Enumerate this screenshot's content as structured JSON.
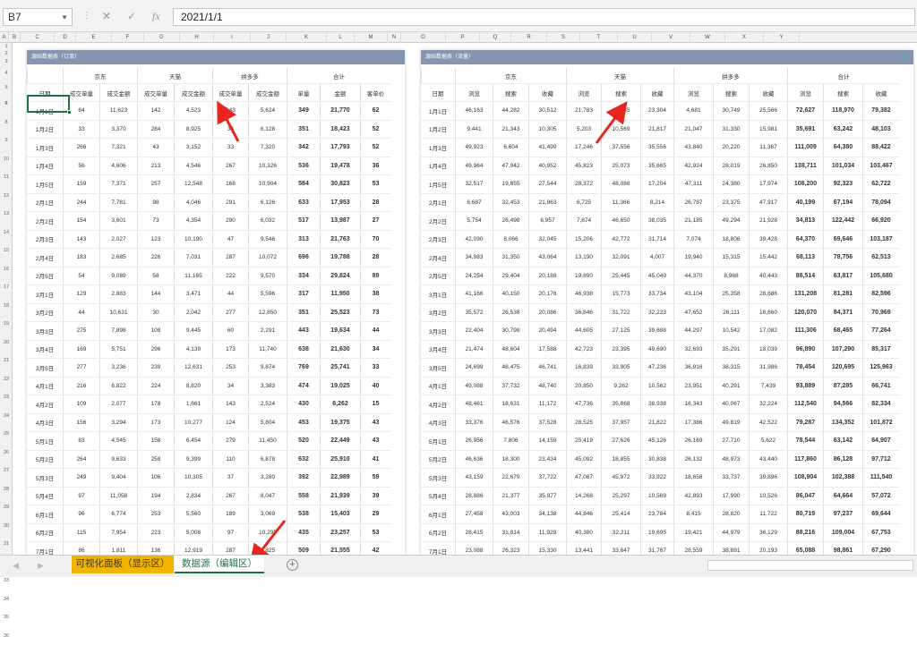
{
  "formula_bar": {
    "cell_ref": "B7",
    "formula": "2021/1/1",
    "cancel_icon": "✕",
    "confirm_icon": "✓",
    "fx_label": "fx"
  },
  "columns": [
    "A",
    "B",
    "C",
    "D",
    "E",
    "F",
    "G",
    "H",
    "I",
    "J",
    "K",
    "L",
    "M",
    "N",
    "O",
    "P",
    "Q",
    "R",
    "S",
    "T",
    "U",
    "V",
    "W",
    "X",
    "Y"
  ],
  "rows": [
    "1",
    "2",
    "3",
    "4",
    "5",
    "6",
    "7",
    "8",
    "9",
    "10",
    "11",
    "12",
    "13",
    "14",
    "15",
    "16",
    "17",
    "18",
    "19",
    "20",
    "21",
    "22",
    "23",
    "24",
    "25",
    "26",
    "27",
    "28",
    "29",
    "30",
    "31",
    "32",
    "33",
    "34",
    "35",
    "36"
  ],
  "left_table": {
    "title": "源始数据表（订单）",
    "group_headers": {
      "jd": "京东",
      "tmall": "天猫",
      "pdd": "拼多多",
      "total": "合计"
    },
    "headers": [
      "日期",
      "成交单量",
      "成交金额",
      "成交单量",
      "成交金额",
      "成交单量",
      "成交金额",
      "单量",
      "金额",
      "客单价"
    ],
    "rows": [
      [
        "1月1日",
        "64",
        "11,623",
        "142",
        "4,523",
        "143",
        "5,624",
        "349",
        "21,770",
        "62"
      ],
      [
        "1月2日",
        "33",
        "3,370",
        "284",
        "8,925",
        "34",
        "6,128",
        "351",
        "18,423",
        "52"
      ],
      [
        "1月3日",
        "266",
        "7,321",
        "43",
        "3,152",
        "33",
        "7,320",
        "342",
        "17,793",
        "52"
      ],
      [
        "1月4日",
        "56",
        "4,606",
        "213",
        "4,546",
        "267",
        "10,326",
        "536",
        "19,478",
        "36"
      ],
      [
        "1月5日",
        "159",
        "7,371",
        "257",
        "12,548",
        "168",
        "10,904",
        "584",
        "30,823",
        "53"
      ],
      [
        "2月1日",
        "244",
        "7,781",
        "98",
        "4,046",
        "291",
        "6,126",
        "633",
        "17,953",
        "28"
      ],
      [
        "2月2日",
        "154",
        "3,601",
        "73",
        "4,354",
        "290",
        "6,032",
        "517",
        "13,987",
        "27"
      ],
      [
        "2月3日",
        "143",
        "2,027",
        "123",
        "10,190",
        "47",
        "9,546",
        "313",
        "21,763",
        "70"
      ],
      [
        "2月4日",
        "183",
        "2,685",
        "226",
        "7,031",
        "287",
        "10,072",
        "696",
        "19,788",
        "28"
      ],
      [
        "2月5日",
        "54",
        "9,089",
        "58",
        "11,165",
        "222",
        "9,570",
        "334",
        "29,824",
        "89"
      ],
      [
        "3月1日",
        "129",
        "2,883",
        "144",
        "3,471",
        "44",
        "5,596",
        "317",
        "11,950",
        "38"
      ],
      [
        "3月2日",
        "44",
        "10,631",
        "30",
        "2,042",
        "277",
        "12,850",
        "351",
        "25,523",
        "73"
      ],
      [
        "3月3日",
        "275",
        "7,898",
        "108",
        "9,445",
        "60",
        "2,291",
        "443",
        "19,634",
        "44"
      ],
      [
        "3月4日",
        "169",
        "5,751",
        "296",
        "4,139",
        "173",
        "11,740",
        "638",
        "21,630",
        "34"
      ],
      [
        "3月5日",
        "277",
        "3,236",
        "239",
        "12,631",
        "253",
        "9,874",
        "769",
        "25,741",
        "33"
      ],
      [
        "4月1日",
        "216",
        "6,822",
        "224",
        "8,820",
        "34",
        "3,383",
        "474",
        "19,025",
        "40"
      ],
      [
        "4月2日",
        "109",
        "2,077",
        "178",
        "1,661",
        "143",
        "2,524",
        "430",
        "6,262",
        "15"
      ],
      [
        "4月3日",
        "156",
        "3,294",
        "173",
        "10,277",
        "124",
        "5,804",
        "453",
        "19,375",
        "43"
      ],
      [
        "5月1日",
        "83",
        "4,545",
        "158",
        "6,454",
        "279",
        "11,450",
        "520",
        "22,449",
        "43"
      ],
      [
        "5月2日",
        "264",
        "9,633",
        "258",
        "9,399",
        "110",
        "6,878",
        "632",
        "25,910",
        "41"
      ],
      [
        "5月3日",
        "249",
        "9,404",
        "106",
        "10,305",
        "37",
        "3,280",
        "392",
        "22,989",
        "59"
      ],
      [
        "5月4日",
        "97",
        "11,058",
        "194",
        "2,834",
        "267",
        "8,047",
        "558",
        "21,939",
        "39"
      ],
      [
        "6月1日",
        "96",
        "6,774",
        "253",
        "5,560",
        "189",
        "3,069",
        "538",
        "15,403",
        "29"
      ],
      [
        "6月2日",
        "115",
        "7,954",
        "223",
        "5,008",
        "97",
        "10,295",
        "435",
        "23,257",
        "53"
      ],
      [
        "7月1日",
        "86",
        "1,811",
        "136",
        "12,919",
        "287",
        "6,825",
        "509",
        "21,555",
        "42"
      ],
      [
        "7月2日",
        "216",
        "2,572",
        "249",
        "9,822",
        "56",
        "5,107",
        "521",
        "17,501",
        "34"
      ],
      [
        "7月3日",
        "190",
        "9,612",
        "24",
        "3,271",
        "251",
        "4,088",
        "465",
        "16,971",
        "36"
      ],
      [
        "7月4日",
        "144",
        "10,579",
        "61",
        "3,594",
        "151",
        "10,879",
        "356",
        "25,052",
        "70"
      ],
      [
        "8月1日",
        "55",
        "5,811",
        "226",
        "10,472",
        "256",
        "7,344",
        "537",
        "23,627",
        "44"
      ],
      [
        "8月2日",
        "172",
        "9,321",
        "292",
        "4,267",
        "42",
        "4,464",
        "506",
        "18,052",
        "36"
      ]
    ]
  },
  "right_table": {
    "title": "源始数据表（流量）",
    "group_headers": {
      "jd": "京东",
      "tmall": "天猫",
      "pdd": "拼多多",
      "total": "合计"
    },
    "headers": [
      "日期",
      "浏览",
      "搜索",
      "收藏",
      "浏览",
      "搜索",
      "收藏",
      "浏览",
      "搜索",
      "收藏",
      "浏览",
      "搜索",
      "收藏"
    ],
    "rows": [
      [
        "1月1日",
        "46,163",
        "44,282",
        "30,512",
        "21,783",
        "43,835",
        "23,304",
        "4,681",
        "30,749",
        "25,566",
        "72,627",
        "118,970",
        "79,382"
      ],
      [
        "1月2日",
        "9,441",
        "21,343",
        "10,305",
        "5,203",
        "10,569",
        "21,817",
        "21,047",
        "31,330",
        "15,981",
        "35,691",
        "63,242",
        "48,103"
      ],
      [
        "1月3日",
        "49,923",
        "6,604",
        "41,499",
        "17,246",
        "37,556",
        "35,556",
        "43,840",
        "20,220",
        "11,367",
        "111,009",
        "64,380",
        "88,422"
      ],
      [
        "1月4日",
        "49,964",
        "47,942",
        "40,952",
        "45,823",
        "25,073",
        "35,665",
        "42,924",
        "28,019",
        "26,850",
        "138,711",
        "101,034",
        "103,467"
      ],
      [
        "1月5日",
        "32,517",
        "19,855",
        "27,544",
        "28,372",
        "48,088",
        "17,204",
        "47,311",
        "24,380",
        "17,974",
        "108,200",
        "92,323",
        "62,722"
      ],
      [
        "2月1日",
        "6,687",
        "32,453",
        "21,963",
        "6,725",
        "11,366",
        "8,214",
        "26,787",
        "23,375",
        "47,917",
        "40,199",
        "67,194",
        "78,094"
      ],
      [
        "2月2日",
        "5,754",
        "26,498",
        "6,957",
        "7,874",
        "46,650",
        "38,035",
        "21,185",
        "49,294",
        "21,928",
        "34,813",
        "122,442",
        "66,920"
      ],
      [
        "2月3日",
        "42,090",
        "8,066",
        "32,045",
        "15,206",
        "42,772",
        "31,714",
        "7,074",
        "18,808",
        "39,428",
        "64,370",
        "69,646",
        "103,187"
      ],
      [
        "2月4日",
        "34,983",
        "31,350",
        "43,064",
        "13,190",
        "32,091",
        "4,007",
        "19,940",
        "15,315",
        "15,442",
        "68,113",
        "78,756",
        "62,513"
      ],
      [
        "2月5日",
        "24,254",
        "29,404",
        "20,188",
        "19,890",
        "25,445",
        "45,049",
        "44,370",
        "8,968",
        "40,443",
        "88,514",
        "63,817",
        "105,680"
      ],
      [
        "3月1日",
        "41,166",
        "40,150",
        "20,176",
        "46,938",
        "15,773",
        "33,734",
        "43,104",
        "25,358",
        "28,686",
        "131,208",
        "81,281",
        "82,596"
      ],
      [
        "3月2日",
        "35,572",
        "26,538",
        "20,086",
        "36,846",
        "31,722",
        "32,223",
        "47,652",
        "26,111",
        "18,660",
        "120,070",
        "84,371",
        "70,969"
      ],
      [
        "3月3日",
        "22,404",
        "30,798",
        "20,494",
        "44,605",
        "27,125",
        "39,688",
        "44,297",
        "10,542",
        "17,082",
        "111,306",
        "68,465",
        "77,264"
      ],
      [
        "3月4日",
        "21,474",
        "48,604",
        "17,588",
        "42,723",
        "23,395",
        "49,690",
        "32,693",
        "35,291",
        "18,039",
        "96,890",
        "107,290",
        "85,317"
      ],
      [
        "3月5日",
        "24,699",
        "48,475",
        "46,741",
        "16,839",
        "33,905",
        "47,236",
        "36,916",
        "38,315",
        "31,986",
        "78,454",
        "120,695",
        "125,963"
      ],
      [
        "4月1日",
        "49,088",
        "37,732",
        "48,740",
        "20,850",
        "9,262",
        "10,562",
        "23,951",
        "40,291",
        "7,439",
        "93,889",
        "87,285",
        "66,741"
      ],
      [
        "4月2日",
        "48,461",
        "18,631",
        "11,172",
        "47,736",
        "35,868",
        "38,938",
        "16,343",
        "40,067",
        "32,224",
        "112,540",
        "94,566",
        "82,334"
      ],
      [
        "4月3日",
        "33,376",
        "46,576",
        "37,528",
        "28,525",
        "37,957",
        "21,822",
        "17,386",
        "49,819",
        "42,522",
        "79,287",
        "134,352",
        "101,872"
      ],
      [
        "5月1日",
        "26,956",
        "7,806",
        "14,159",
        "25,419",
        "27,626",
        "45,126",
        "26,169",
        "27,710",
        "5,622",
        "78,544",
        "63,142",
        "64,907"
      ],
      [
        "5月2日",
        "46,636",
        "18,300",
        "23,434",
        "45,092",
        "18,855",
        "30,838",
        "26,132",
        "48,973",
        "43,440",
        "117,860",
        "86,128",
        "97,712"
      ],
      [
        "5月3日",
        "43,159",
        "22,679",
        "37,722",
        "47,087",
        "45,972",
        "33,922",
        "18,658",
        "33,737",
        "39,896",
        "108,904",
        "102,388",
        "111,540"
      ],
      [
        "5月4日",
        "28,886",
        "21,377",
        "35,977",
        "14,268",
        "25,297",
        "10,569",
        "42,893",
        "17,990",
        "10,526",
        "86,047",
        "64,664",
        "57,072"
      ],
      [
        "6月1日",
        "27,458",
        "43,003",
        "34,138",
        "44,846",
        "25,414",
        "23,784",
        "8,415",
        "28,820",
        "11,722",
        "80,719",
        "97,237",
        "69,644"
      ],
      [
        "6月2日",
        "28,415",
        "31,814",
        "11,929",
        "40,380",
        "32,211",
        "19,695",
        "19,421",
        "44,979",
        "36,129",
        "88,216",
        "109,004",
        "67,753"
      ],
      [
        "7月1日",
        "23,088",
        "26,323",
        "15,330",
        "13,441",
        "33,647",
        "31,767",
        "28,559",
        "38,891",
        "20,193",
        "65,088",
        "98,861",
        "67,290"
      ],
      [
        "7月2日",
        "25,500",
        "14,988",
        "47,101",
        "28,710",
        "4,721",
        "43,448",
        "31,722",
        "4,242",
        "15,417",
        "85,932",
        "23,951",
        "105,966"
      ],
      [
        "7月3日",
        "27,077",
        "31,119",
        "26,320",
        "48,684",
        "25,776",
        "12,706",
        "31,239",
        "16,096",
        "32,942",
        "107,000",
        "72,991",
        "71,968"
      ],
      [
        "7月4日",
        "5,893",
        "38,741",
        "32,171",
        "22,391",
        "25,194",
        "23,060",
        "12,168",
        "43,357",
        "21,924",
        "54,733",
        "107,292",
        "77,095"
      ],
      [
        "8月1日",
        "37,033",
        "27,928",
        "6,076",
        "45,211",
        "22,806",
        "42,036",
        "12,448",
        "31,744",
        "42,880",
        "94,692",
        "82,478",
        "80,992"
      ],
      [
        "8月2日",
        "11,449",
        "23,952",
        "45,360",
        "44,490",
        "21,734",
        "25,097",
        "7,521",
        "37,164",
        "11,155",
        "63,460",
        "82,850",
        "81,612"
      ]
    ]
  },
  "sheet_tabs": [
    {
      "label": "可视化面板（显示区）",
      "color": "#f2b400"
    },
    {
      "label": "数据源（编辑区）",
      "color": "#1e7145"
    }
  ],
  "add_sheet_icon": "+",
  "colors": {
    "title_bar": "#8596b0",
    "selection": "#1e7145",
    "arrow": "#e8251e"
  }
}
